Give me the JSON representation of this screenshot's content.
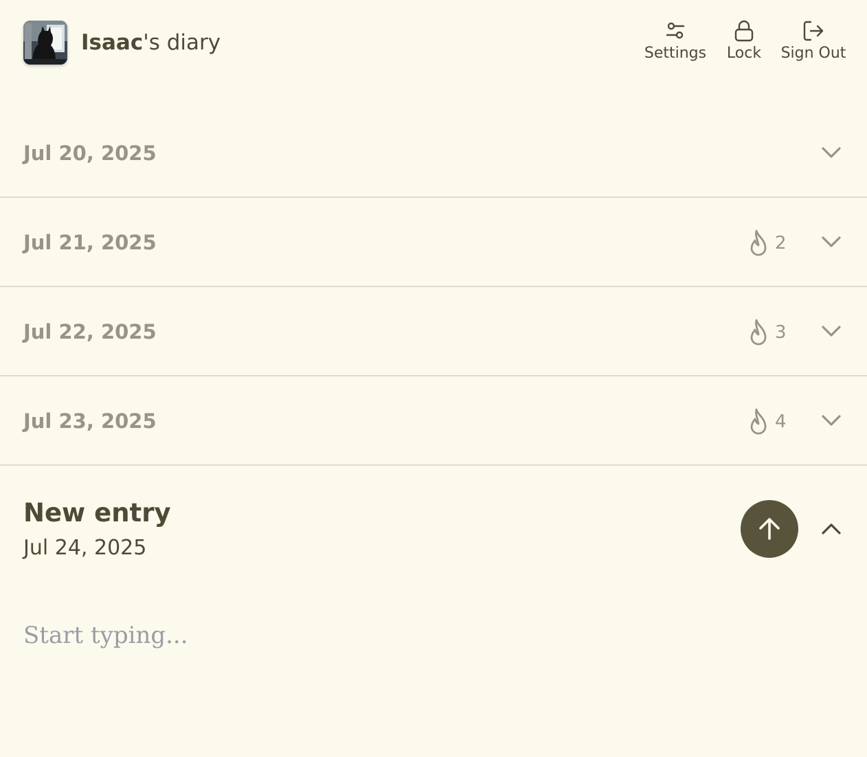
{
  "header": {
    "title_name": "Isaac",
    "title_suffix": "'s diary",
    "avatar_icon": "black-cat-photo-icon",
    "actions": [
      {
        "label": "Settings",
        "icon": "sliders-icon"
      },
      {
        "label": "Lock",
        "icon": "lock-icon"
      },
      {
        "label": "Sign Out",
        "icon": "sign-out-icon"
      }
    ]
  },
  "entries": [
    {
      "date": "Jul 20, 2025",
      "streak": null
    },
    {
      "date": "Jul 21, 2025",
      "streak": "2"
    },
    {
      "date": "Jul 22, 2025",
      "streak": "3"
    },
    {
      "date": "Jul 23, 2025",
      "streak": "4"
    }
  ],
  "new_entry": {
    "title": "New entry",
    "date": "Jul 24, 2025",
    "placeholder": "Start typing...",
    "submit_icon": "arrow-up-icon",
    "collapse_icon": "chevron-up-icon"
  },
  "colors": {
    "background": "#fcfaec",
    "text": "#4d4b35",
    "muted": "#979583",
    "accent_button": "#58543c",
    "divider": "#dedcd0",
    "placeholder": "#9b9ca7"
  }
}
